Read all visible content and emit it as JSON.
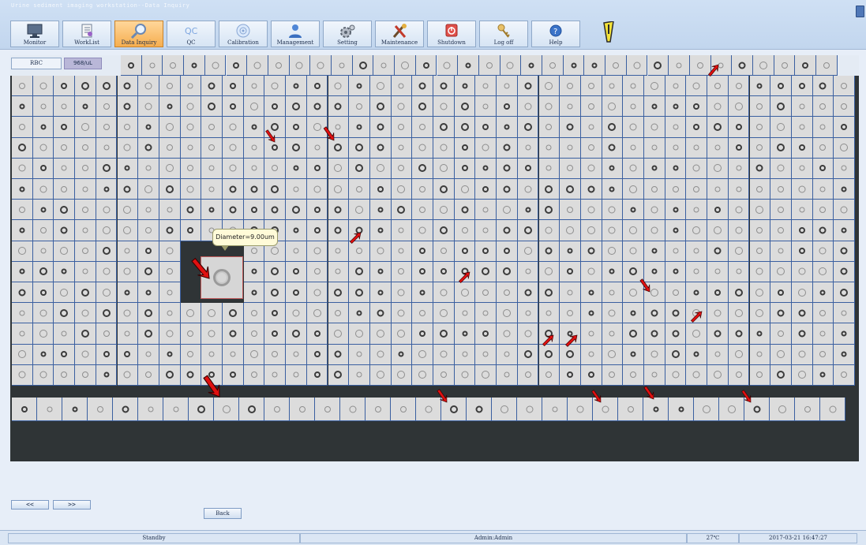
{
  "app": {
    "title": "Urine sediment imaging workstation--Data Inquiry"
  },
  "toolbar": {
    "buttons": [
      {
        "label": "Monitor",
        "icon": "monitor-icon"
      },
      {
        "label": "WorkList",
        "icon": "worklist-icon"
      },
      {
        "label": "Data Inquiry",
        "icon": "magnifier-icon",
        "active": true
      },
      {
        "label": "QC",
        "icon": "qc-icon"
      },
      {
        "label": "Calibration",
        "icon": "calibration-icon"
      },
      {
        "label": "Management",
        "icon": "user-icon"
      },
      {
        "label": "Setting",
        "icon": "gear-icon"
      },
      {
        "label": "Maintenance",
        "icon": "tools-icon"
      },
      {
        "label": "Shutdown",
        "icon": "power-icon"
      },
      {
        "label": "Log off",
        "icon": "key-icon"
      },
      {
        "label": "Help",
        "icon": "help-icon"
      }
    ],
    "qc_glyph": "QC"
  },
  "panel": {
    "category_tab": "RBC",
    "count_tab": "968/uL",
    "tooltip": "Diameter=9.00um"
  },
  "nav": {
    "prev": "<<",
    "next": ">>",
    "back": "Back"
  },
  "status": {
    "state": "Standby",
    "user": "Admin:Admin",
    "temperature": "27℃",
    "datetime": "2017-03-21 16:47:27"
  },
  "colors": {
    "accent": "#f6ae4f",
    "grid_line": "#3a5fa0",
    "arrow": "#e01010"
  }
}
